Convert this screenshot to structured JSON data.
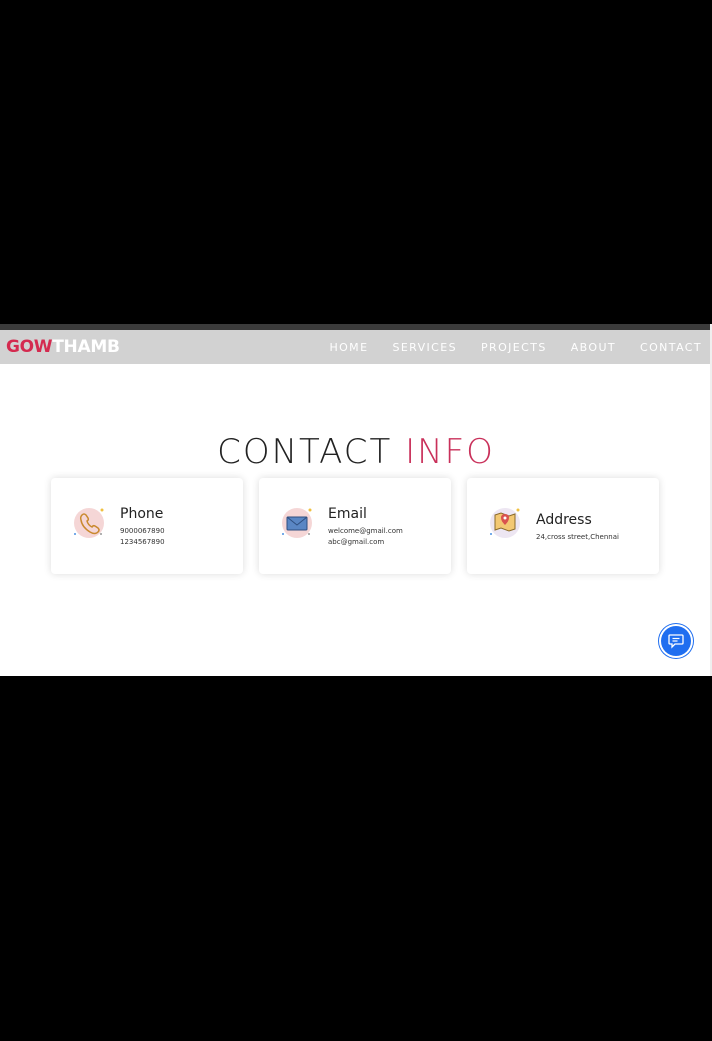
{
  "logo": {
    "red_part": "GOW",
    "white_part": "THAMB"
  },
  "nav": {
    "items": [
      "HOME",
      "SERVICES",
      "PROJECTS",
      "ABOUT",
      "CONTACT"
    ]
  },
  "section": {
    "title_dark": "CONTACT",
    "title_accent": "INFO"
  },
  "cards": [
    {
      "icon": "phone-icon",
      "heading": "Phone",
      "lines": [
        "9000067890",
        "1234567890"
      ]
    },
    {
      "icon": "email-icon",
      "heading": "Email",
      "lines": [
        "welcome@gmail.com",
        "abc@gmail.com"
      ]
    },
    {
      "icon": "map-pin-icon",
      "heading": "Address",
      "lines": [
        "24,cross street,Chennai"
      ]
    }
  ],
  "chat": {
    "icon": "chat-icon"
  },
  "colors": {
    "accent": "#c9305a",
    "logo_red": "#d42a4f",
    "nav_bg": "#d2d2d2",
    "chat_blue": "#1f6ef0"
  }
}
